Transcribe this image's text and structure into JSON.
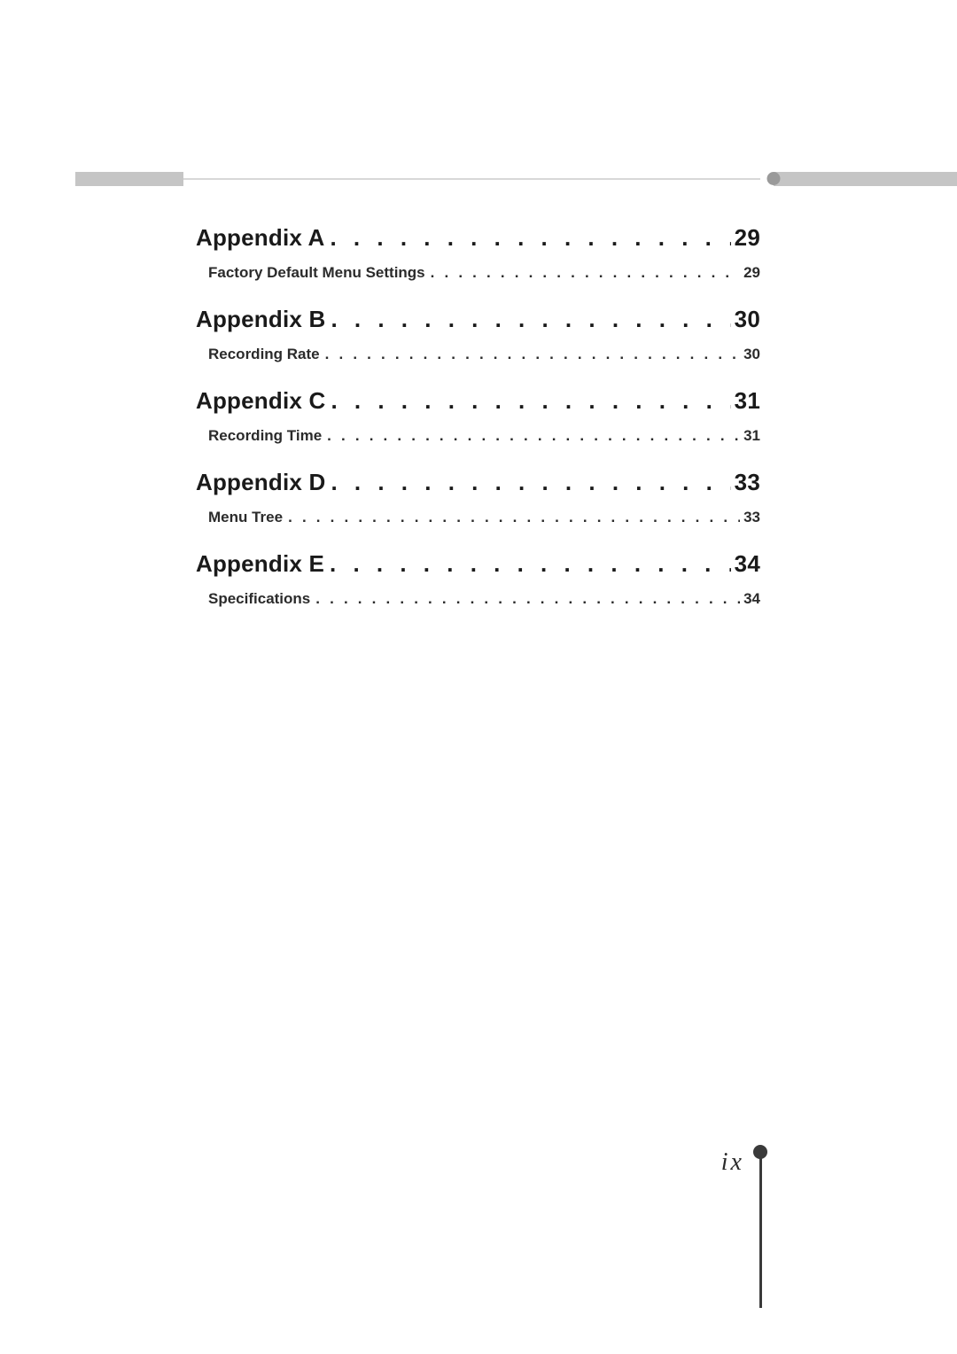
{
  "toc": [
    {
      "level": "major",
      "label": "Appendix A",
      "page": "29"
    },
    {
      "level": "minor",
      "label": "Factory Default Menu Settings",
      "page": "29"
    },
    {
      "level": "major",
      "label": "Appendix B",
      "page": "30"
    },
    {
      "level": "minor",
      "label": "Recording Rate",
      "page": "30"
    },
    {
      "level": "major",
      "label": "Appendix C",
      "page": "31"
    },
    {
      "level": "minor",
      "label": "Recording Time",
      "page": "31"
    },
    {
      "level": "major",
      "label": "Appendix D",
      "page": "33"
    },
    {
      "level": "minor",
      "label": "Menu Tree",
      "page": "33"
    },
    {
      "level": "major",
      "label": "Appendix E",
      "page": "34"
    },
    {
      "level": "minor",
      "label": "Specifications",
      "page": "34"
    }
  ],
  "folio": "ix"
}
